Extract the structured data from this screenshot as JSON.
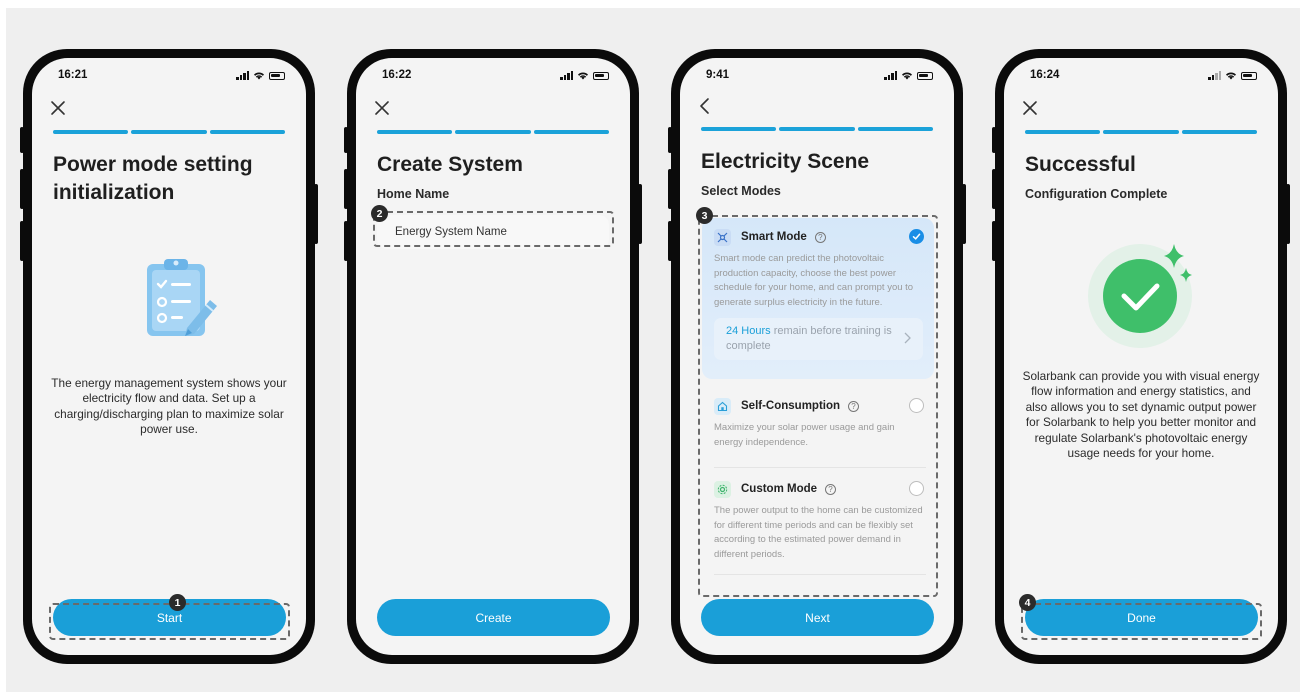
{
  "screens": [
    {
      "status": {
        "time": "16:21"
      },
      "title_line1": "Power mode setting",
      "title_line2": "initialization",
      "description": "The energy management system shows your electricity flow and data. Set up a charging/discharging plan to maximize solar power use.",
      "button": "Start",
      "marker": "1"
    },
    {
      "status": {
        "time": "16:22"
      },
      "title": "Create System",
      "subtitle": "Home Name",
      "input_value": "Energy System Name",
      "button": "Create",
      "marker": "2"
    },
    {
      "status": {
        "time": "9:41"
      },
      "title": "Electricity Scene",
      "subtitle": "Select Modes",
      "marker": "3",
      "modes": [
        {
          "name": "Smart Mode",
          "selected": true,
          "description": "Smart mode can predict the photovoltaic production capacity, choose the best power schedule for your home, and can prompt you to generate surplus electricity in the future.",
          "info_highlight": "24 Hours",
          "info_text": "remain before training is complete"
        },
        {
          "name": "Self-Consumption",
          "selected": false,
          "description": "Maximize your solar power usage and gain energy independence."
        },
        {
          "name": "Custom Mode",
          "selected": false,
          "description": "The power output to the home can be customized for different time periods and can be flexibly set according to the estimated power demand in different periods."
        }
      ],
      "help_glyph": "?",
      "button": "Next"
    },
    {
      "status": {
        "time": "16:24"
      },
      "title": "Successful",
      "subtitle": "Configuration Complete",
      "description": "Solarbank can provide you with visual energy flow information and energy statistics, and also allows you to set dynamic output power for Solarbank to help you better monitor and regulate Solarbank's photovoltaic energy usage needs for your home.",
      "button": "Done",
      "marker": "4"
    }
  ],
  "colors": {
    "accent": "#1a9fd8",
    "progress": "#1ba2d9",
    "success_green": "#3fbf6a",
    "selected_blue": "#1a8ee6",
    "phone_frame": "#0b0b0b",
    "screen_bg": "#f4f4f4",
    "canvas_bg": "#efefef"
  },
  "icons": {
    "screen1_nav": "close-icon",
    "screen2_nav": "close-icon",
    "screen3_nav": "back-arrow-icon",
    "screen4_nav": "close-icon",
    "illustration1": "clipboard-checklist-pencil-icon",
    "illustration4": "success-checkmark-sparkle-icon"
  }
}
